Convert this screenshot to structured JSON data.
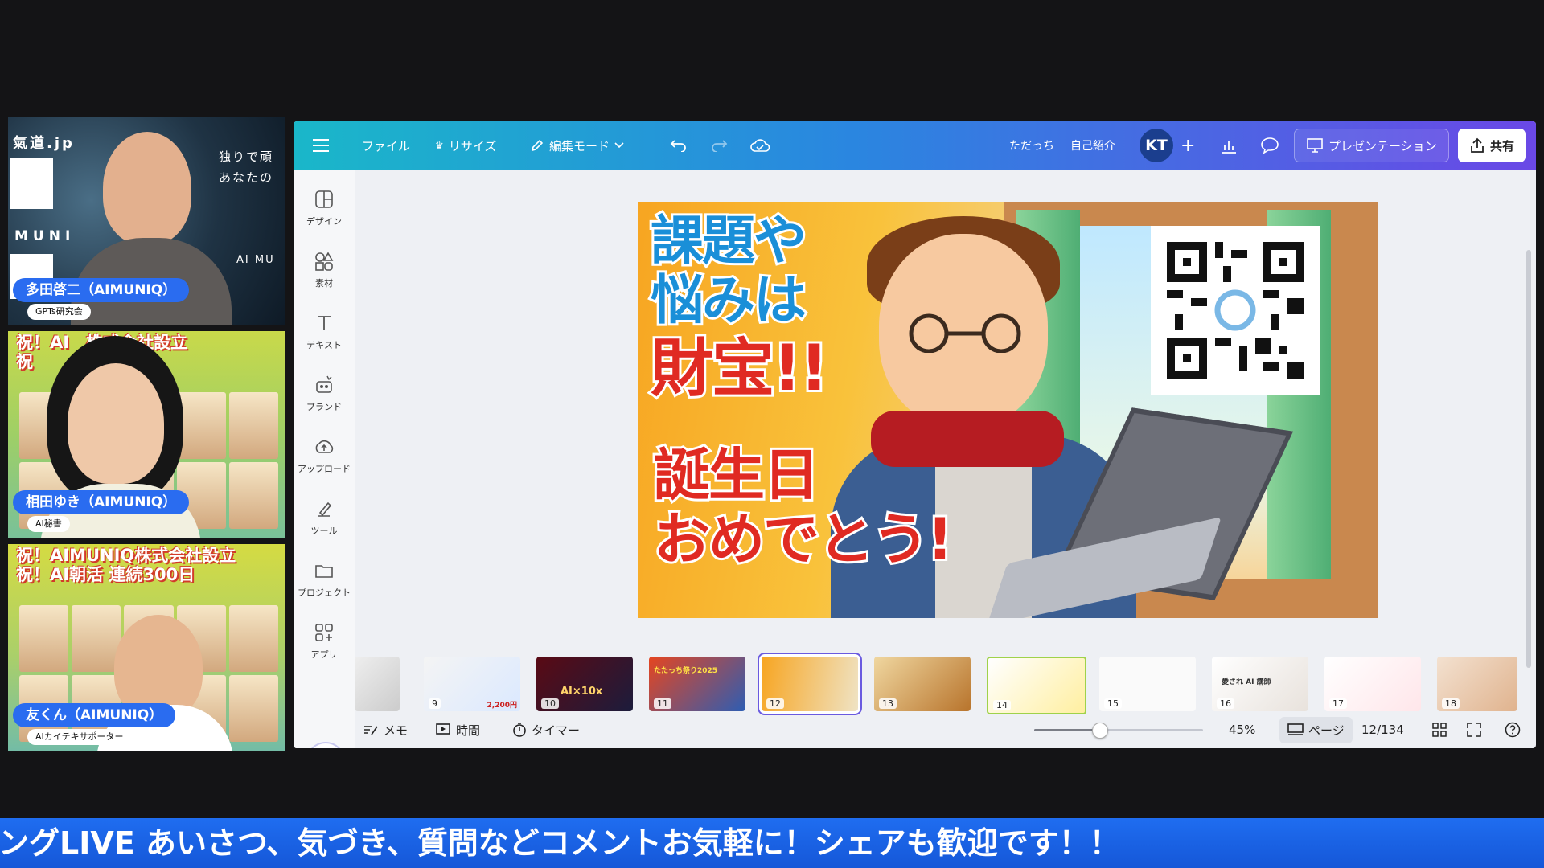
{
  "participants": [
    {
      "name": "多田啓二（AIMUNIQ）",
      "role": "GPTs研究会",
      "bg_text_left": "氣道.jp",
      "bg_text_right": "独りで頑\nあなたの",
      "bg_text_muni": "MUNI",
      "bg_text_ai": "AI MU"
    },
    {
      "name": "相田ゆき（AIMUNIQ）",
      "role": "AI秘書",
      "banner": "祝！AI     株式会社設立\n祝             続300日"
    },
    {
      "name": "友くん（AIMUNIQ）",
      "role": "AIカイテキサポーター",
      "banner": "祝！AIMUNIQ株式会社設立\n祝！AI朝活 連続300日"
    }
  ],
  "toolbar": {
    "file": "ファイル",
    "resize": "リサイズ",
    "edit_mode": "編集モード",
    "user_name": "ただっち",
    "doc_title": "自己紹介",
    "avatar_initials": "KT",
    "present": "プレゼンテーション",
    "share": "共有"
  },
  "sidebar": {
    "items": [
      {
        "label": "デザイン",
        "icon": "design-icon"
      },
      {
        "label": "素材",
        "icon": "elements-icon"
      },
      {
        "label": "テキスト",
        "icon": "text-icon"
      },
      {
        "label": "ブランド",
        "icon": "brand-icon"
      },
      {
        "label": "アップロード",
        "icon": "upload-icon"
      },
      {
        "label": "ツール",
        "icon": "tools-icon"
      },
      {
        "label": "プロジェクト",
        "icon": "projects-icon"
      },
      {
        "label": "アプリ",
        "icon": "apps-icon"
      }
    ]
  },
  "slide": {
    "title_line1": "課題や",
    "title_line2": "悩みは",
    "title_line3": "財宝!!",
    "subtitle_line1": "誕生日",
    "subtitle_line2": "おめでとう!"
  },
  "filmstrip": {
    "pages": [
      "9",
      "10",
      "11",
      "12",
      "13",
      "14",
      "15",
      "16",
      "17",
      "18"
    ],
    "current": "12",
    "thumb_texts": {
      "t9_price": "2,200円",
      "t10_label": "AI×10x",
      "t11_label": "たたっち祭り2025",
      "t16_label": "愛され AI 講師"
    }
  },
  "bottombar": {
    "notes": "メモ",
    "duration": "時間",
    "timer": "タイマー",
    "zoom": "45%",
    "zoom_fraction": 0.45,
    "pages": "ページ",
    "page_counter": "12/134"
  },
  "ticker": "ングLIVE あいさつ、気づき、質問などコメントお気軽に！シェアも歓迎です！！",
  "colors": {
    "accent": "#2a6cf0",
    "topbar_start": "#1ab7c9",
    "topbar_end": "#6a48e6",
    "ticker": "#1f6df0"
  }
}
